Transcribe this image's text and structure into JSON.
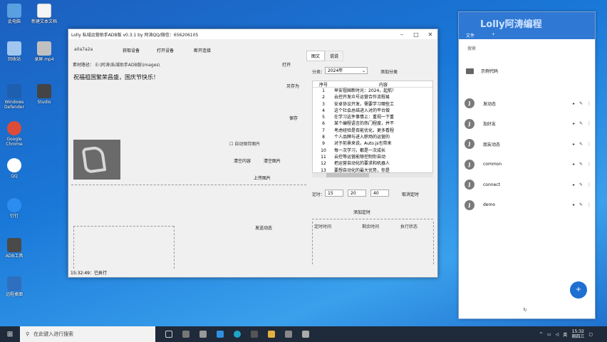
{
  "desktop": {
    "icons": [
      {
        "label": "此电脑",
        "color": "#5a9fe0"
      },
      {
        "label": "回收站",
        "color": "#9fc7f0"
      },
      {
        "label": "Windows Defender",
        "color": "#1f5fb0"
      },
      {
        "label": "Google Chrome",
        "color": "#dd4b39"
      },
      {
        "label": "QQ",
        "color": "#ffffff"
      },
      {
        "label": "钉钉",
        "color": "#2c8df0"
      },
      {
        "label": "ADB工具",
        "color": "#4a4a4a"
      },
      {
        "label": "远程桌面",
        "color": "#2f6fbf"
      },
      {
        "label": "新建文本文档",
        "color": "#f5f5f5"
      },
      {
        "label": "录屏.mp4",
        "color": "#c0c0c0"
      },
      {
        "label": "Studio",
        "color": "#444444"
      }
    ]
  },
  "app": {
    "title": "Lolly 私域运营助手ADB版 v0.3.1 by 阿涛QQ/微信：656206105",
    "device_id": "a0a7a2a",
    "buttons": {
      "get_device": "获取设备",
      "open_device": "打开设备",
      "disconnect": "断开连接",
      "open": "打开",
      "save_as": "另存为",
      "save": "保存",
      "clear_content": "清空内容",
      "clear_image": "清空图片",
      "upload_image": "上传图片",
      "send_moment": "发送动态",
      "add_timer": "添加定时",
      "add_category": "添加分类",
      "cancel_timer": "取消定时"
    },
    "material_path_label": "素材路径：",
    "material_path_value": "E:\\阿涛\\私域助手ADB版\\images\\",
    "message": "祝福祖国繁荣昌盛，国庆节快乐！",
    "auto_save_image": "自动保存图片",
    "tabs": [
      "图文",
      "说说"
    ],
    "category_label": "分类：",
    "category_value": "2024年",
    "list_headers": [
      "序号",
      "内容"
    ],
    "list_rows": [
      {
        "no": "1",
        "text": "早安祖国新时光：2024，起航！"
      },
      {
        "no": "2",
        "text": "云控开发众号运营合作流程易"
      },
      {
        "no": "3",
        "text": "安卓协议开发，需要学习哪些工"
      },
      {
        "no": "4",
        "text": "这个社会总结进入对的平台做"
      },
      {
        "no": "5",
        "text": "在学习这件事情上：重视一下重"
      },
      {
        "no": "6",
        "text": "某个编程语言的热门程度，并不"
      },
      {
        "no": "7",
        "text": "考虑经验是否能优化，更多看程"
      },
      {
        "no": "8",
        "text": "个人品牌与进入职场的运营的"
      },
      {
        "no": "9",
        "text": "对于前景来说，Auto.js也带来"
      },
      {
        "no": "10",
        "text": "每一次学习，都是一次成长"
      },
      {
        "no": "11",
        "text": "云控等运营能够控制你自动"
      },
      {
        "no": "12",
        "text": "把运营自动化的要求和机器人"
      },
      {
        "no": "13",
        "text": "要想自动化的最大优势，你是"
      }
    ],
    "timer_label": "定时：",
    "timer_hour": "15",
    "timer_minute": "20",
    "timer_second": "40",
    "schedule_headers": [
      "定时时间",
      "剩余时间",
      "执行状态"
    ],
    "status": "15:32:49：已执行"
  },
  "notes_panel": {
    "title": "Lolly阿涛编程",
    "tab_active": "文件",
    "tab_other": "+",
    "search_placeholder": "搜索",
    "folder": "示例代码",
    "items": [
      {
        "avatar": "J",
        "label": "发动态"
      },
      {
        "avatar": "J",
        "label": "加好友"
      },
      {
        "avatar": "J",
        "label": "朋友动态"
      },
      {
        "avatar": "J",
        "label": "common"
      },
      {
        "avatar": "J",
        "label": "connect"
      },
      {
        "avatar": "J",
        "label": "demo"
      }
    ],
    "fab": "+"
  },
  "taskbar": {
    "search_placeholder": "在此键入进行搜索",
    "ime": "英",
    "time": "15:32",
    "date": "周四三"
  }
}
